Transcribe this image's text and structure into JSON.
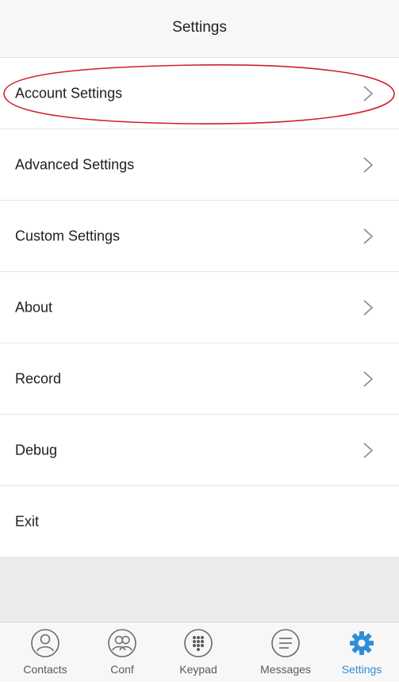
{
  "header": {
    "title": "Settings"
  },
  "settings_items": [
    {
      "label": "Account Settings",
      "has_chevron": true
    },
    {
      "label": "Advanced Settings",
      "has_chevron": true
    },
    {
      "label": "Custom Settings",
      "has_chevron": true
    },
    {
      "label": "About",
      "has_chevron": true
    },
    {
      "label": "Record",
      "has_chevron": true
    },
    {
      "label": "Debug",
      "has_chevron": true
    },
    {
      "label": "Exit",
      "has_chevron": false
    }
  ],
  "tabbar": {
    "tabs": [
      {
        "label": "Contacts",
        "icon": "person-icon",
        "active": false
      },
      {
        "label": "Conf",
        "icon": "group-icon",
        "active": false
      },
      {
        "label": "Keypad",
        "icon": "keypad-icon",
        "active": false
      },
      {
        "label": "Messages",
        "icon": "message-icon",
        "active": false
      },
      {
        "label": "Settings",
        "icon": "gear-icon",
        "active": true
      }
    ]
  },
  "colors": {
    "accent": "#2e8fd6",
    "highlight_ellipse": "#d0202a",
    "empty_area": "#e9ebed"
  }
}
